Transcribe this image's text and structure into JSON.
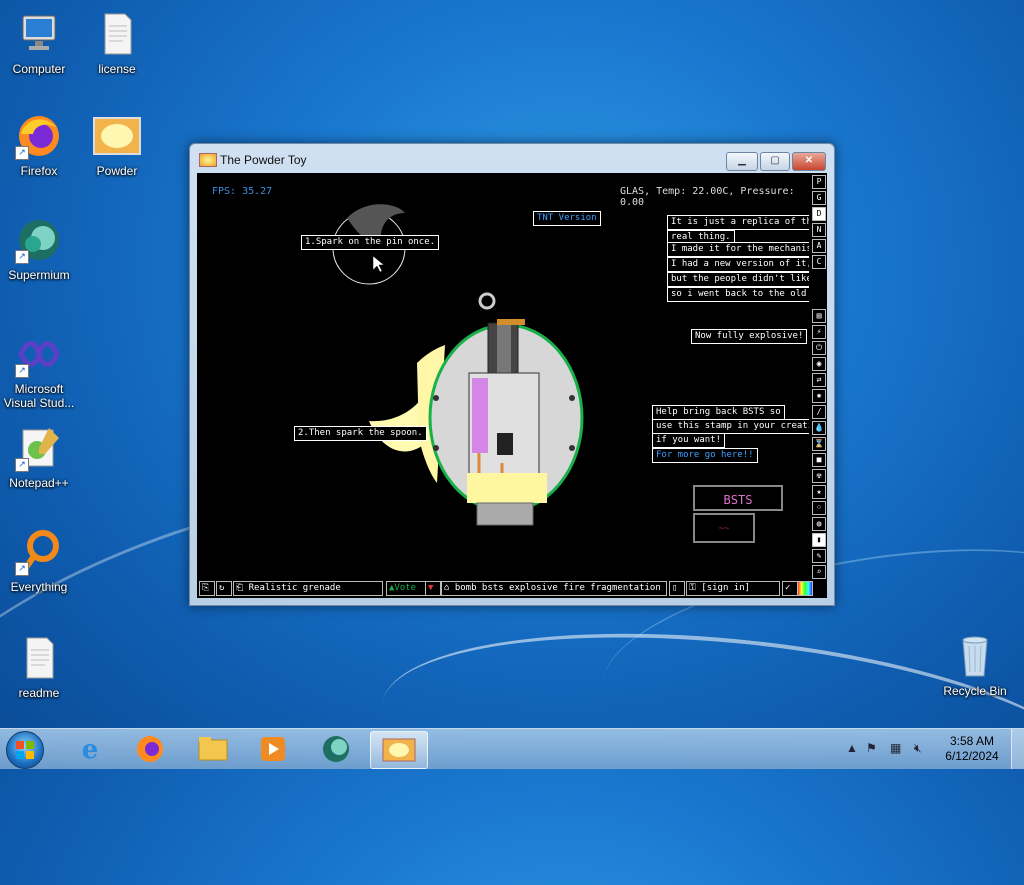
{
  "desktop": {
    "icons": [
      {
        "label": "Computer"
      },
      {
        "label": "license"
      },
      {
        "label": "Firefox"
      },
      {
        "label": "Powder"
      },
      {
        "label": "Supermium"
      },
      {
        "label": "Microsoft Visual Stud..."
      },
      {
        "label": "Notepad++"
      },
      {
        "label": "Everything"
      },
      {
        "label": "readme"
      },
      {
        "label": "Recycle Bin"
      }
    ]
  },
  "window": {
    "title": "The Powder Toy",
    "minimize_icon": "minimize-icon",
    "maximize_icon": "maximize-icon",
    "close_icon": "close-icon"
  },
  "game": {
    "fps": "FPS: 35.27",
    "status": "GLAS, Temp: 22.00C, Pressure: 0.00",
    "notes": {
      "tnt": "TNT Version",
      "step1": "1.Spark on the pin once.",
      "step2": "2.Then spark the spoon.",
      "replica": [
        "It is just a replica of the",
        "real thing.",
        "I made it for the mechanism.",
        "I had a new version of it,",
        "but the people didn't like it,",
        "so i went back to the old one!"
      ],
      "explosive": "Now fully explosive!",
      "bsts": [
        "Help bring back BSTS so",
        "use this stamp in your creatio",
        "if you want!"
      ],
      "more": "For more go here!!",
      "logo": "BSTS"
    },
    "right_tools": [
      "P",
      "G",
      "D",
      "N",
      "A",
      "C"
    ],
    "bottom": {
      "save_name": "Realistic grenade",
      "vote": "Vote",
      "tags": "bomb bsts explosive fire fragmentation g...",
      "sign_in": "[sign in]"
    }
  },
  "taskbar": {
    "time": "3:58 AM",
    "date": "6/12/2024"
  },
  "colors": {
    "accent_green": "#19b04a",
    "note_blue": "#3aa0ff"
  }
}
